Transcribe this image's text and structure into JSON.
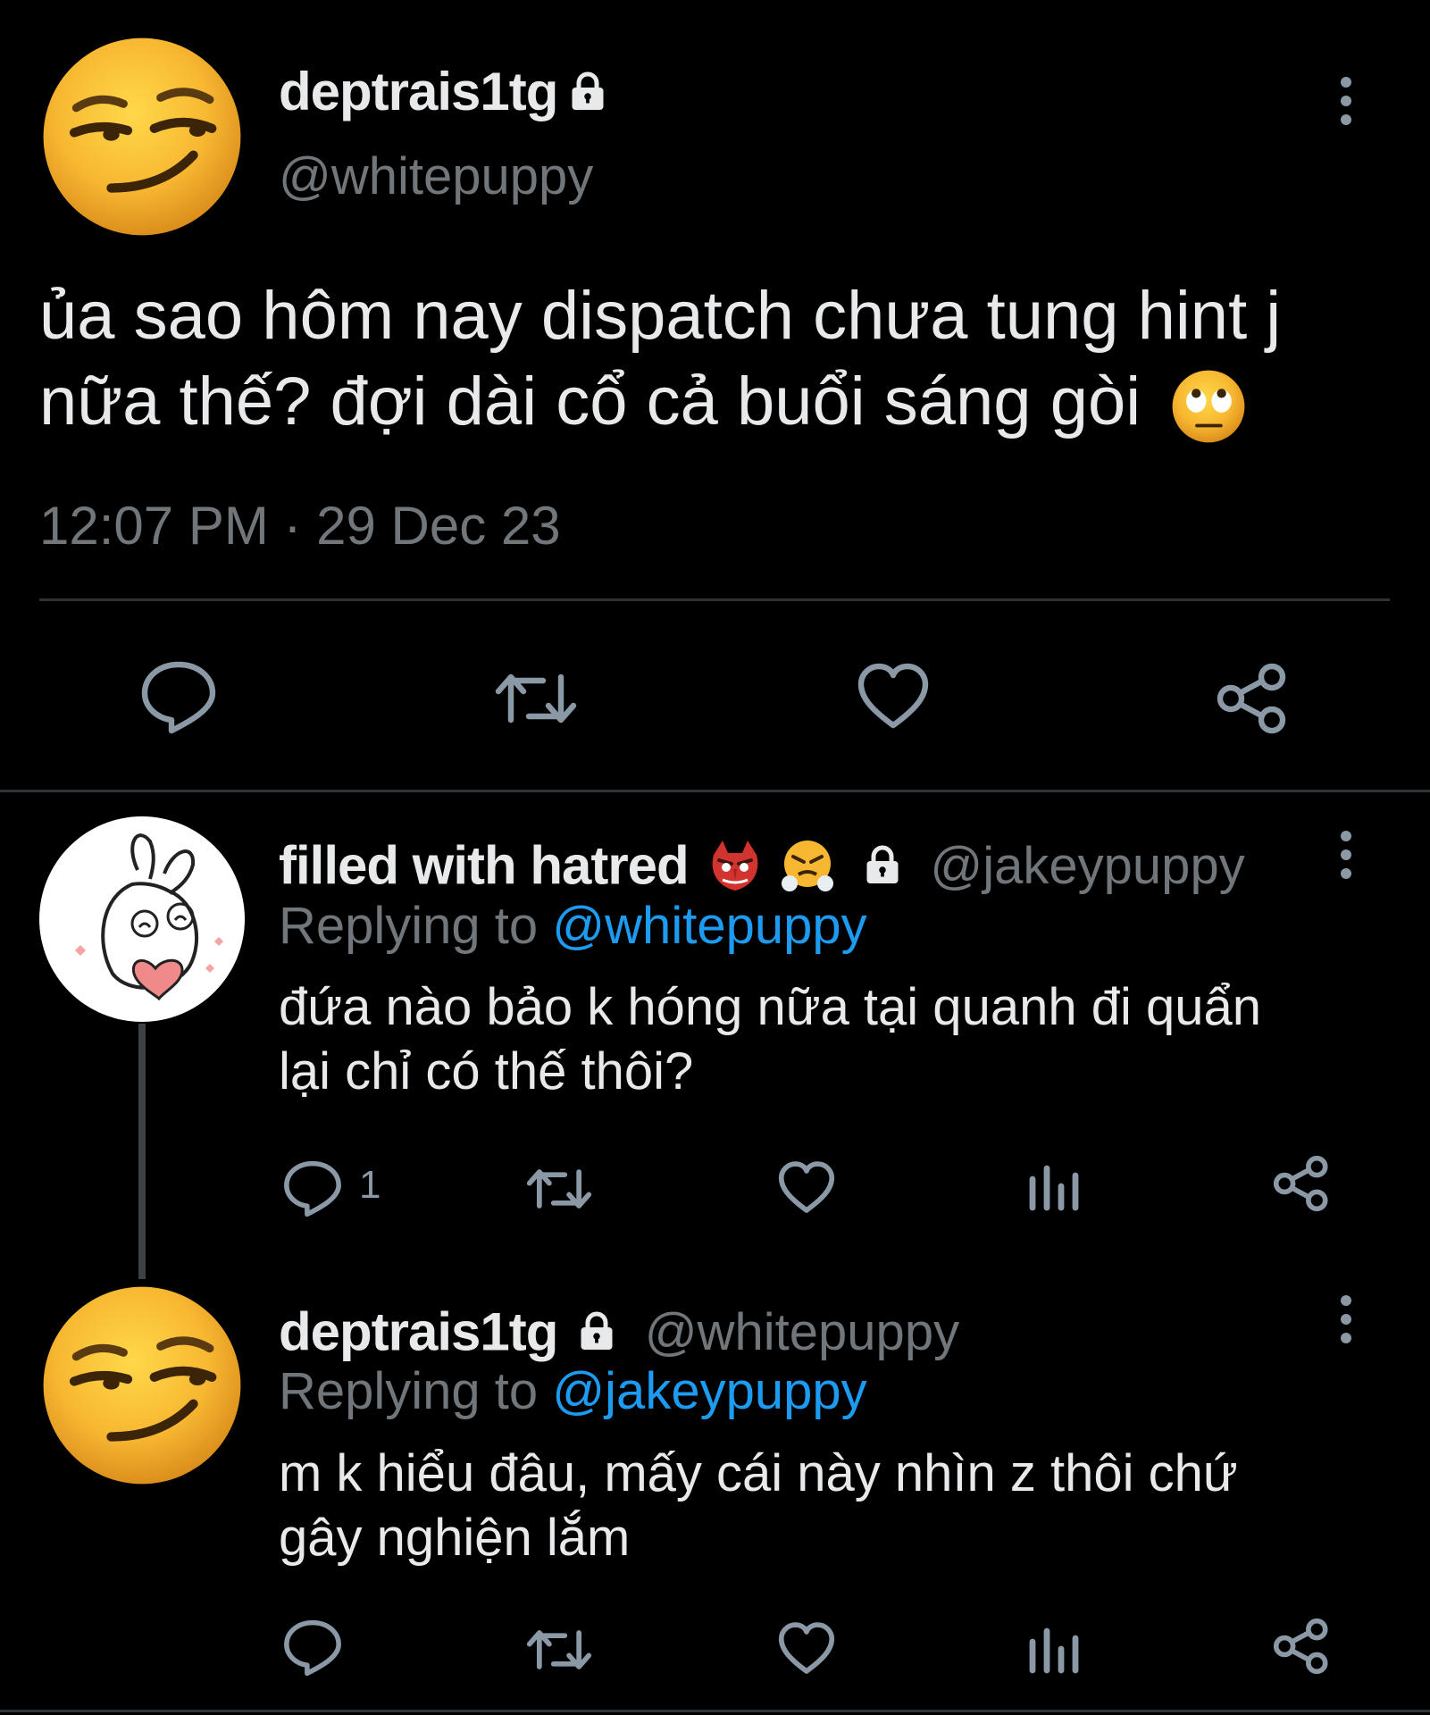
{
  "main_tweet": {
    "display_name": "deptrais1tg",
    "handle": "@whitepuppy",
    "text_line1": "ủa sao hôm nay dispatch chưa tung hint j",
    "text_line2": "nữa thế? đợi dài cổ cả buổi sáng gòi",
    "timestamp": "12:07 PM · 29 Dec 23",
    "avatar_icon": "smirk-emoji-icon",
    "trailing_emoji": "eye-roll-emoji-icon"
  },
  "reply_1": {
    "display_name": "filled with hatred",
    "handle": "@jakeypuppy",
    "replying_prefix": "Replying to",
    "replying_handle": "@whitepuppy",
    "text_line1": "đứa nào bảo k hóng nữa tại quanh đi quẩn",
    "text_line2": "lại chỉ có thế thôi?",
    "reply_count": "1",
    "avatar_icon": "bunny-drawing-icon"
  },
  "reply_2": {
    "display_name": "deptrais1tg",
    "handle": "@whitepuppy",
    "replying_prefix": "Replying to",
    "replying_handle": "@jakeypuppy",
    "text_line1": "m k hiểu đâu, mấy cái này nhìn z thôi chứ",
    "text_line2": "gây nghiện lắm",
    "avatar_icon": "smirk-emoji-icon"
  },
  "colors": {
    "background": "#000000",
    "text": "#e7e9ea",
    "muted": "#71767b",
    "link": "#1d9bf0",
    "divider": "#2f3336"
  }
}
